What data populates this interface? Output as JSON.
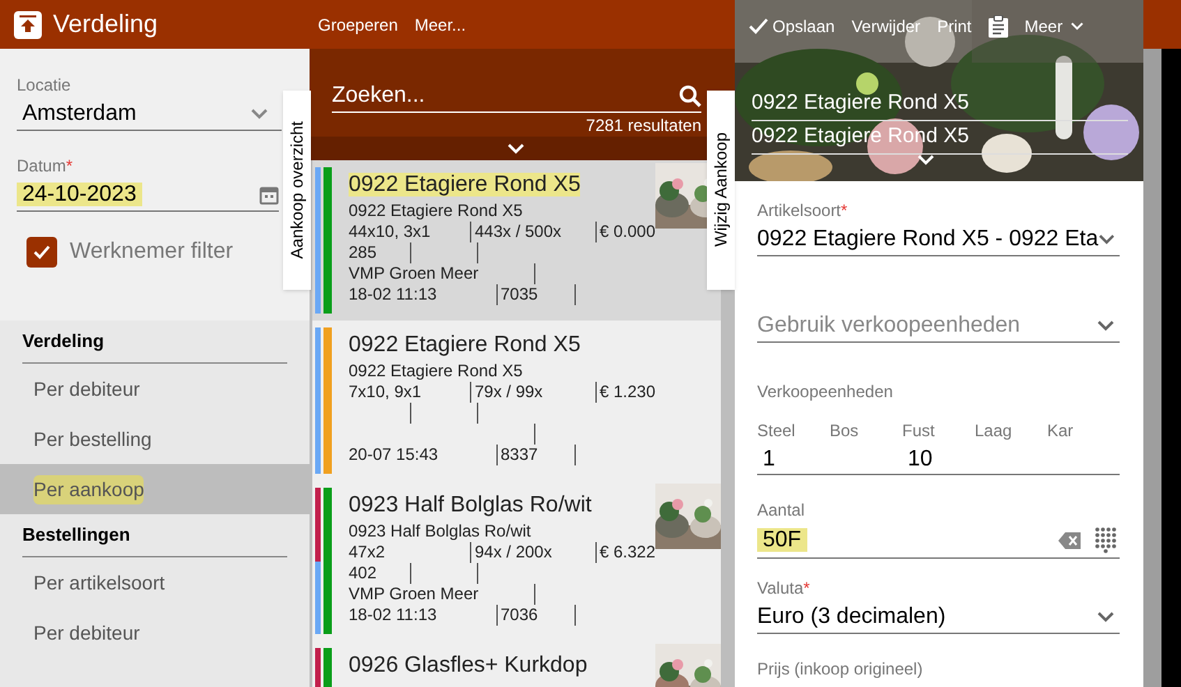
{
  "app_bar": {
    "title": "Verdeling",
    "actions": [
      "Groeperen",
      "Meer..."
    ]
  },
  "filters": {
    "location": {
      "label": "Locatie",
      "value": "Amsterdam"
    },
    "date": {
      "label": "Datum",
      "required_mark": "*",
      "value": "24-10-2023",
      "highlighted": true
    },
    "employee_filter": {
      "label": "Werknemer filter",
      "checked": true
    }
  },
  "menu": [
    {
      "heading": "Verdeling",
      "items": [
        {
          "label": "Per debiteur",
          "selected": false,
          "highlighted": false
        },
        {
          "label": "Per bestelling",
          "selected": false,
          "highlighted": false
        },
        {
          "label": "Per aankoop",
          "selected": true,
          "highlighted": true
        }
      ]
    },
    {
      "heading": "Bestellingen",
      "items": [
        {
          "label": "Per artikelsoort",
          "selected": false,
          "highlighted": false
        },
        {
          "label": "Per debiteur",
          "selected": false,
          "highlighted": false
        }
      ]
    }
  ],
  "overview_tab": "Aankoop overzicht",
  "edit_tab": "Wijzig Aankoop",
  "search": {
    "placeholder": "Zoeken...",
    "result_count": "7281 resultaten"
  },
  "purchases": [
    {
      "title": "0922 Etagiere Rond X5",
      "highlighted": true,
      "selected": true,
      "stripes": [
        {
          "color": "#6aa8f5"
        }
      ],
      "color": "#0a9e1a",
      "subtitle": "0922 Etagiere Rond X5",
      "size": "44x10, 3x1",
      "quantity": "443x / 500x",
      "price": "€ 0.000",
      "count": "285",
      "supplier": "VMP Groen Meer",
      "time": "18-02 11:13",
      "number": "7035",
      "thumbnail": {
        "kind": "picture"
      }
    },
    {
      "title": "0922 Etagiere Rond X5",
      "highlighted": false,
      "selected": false,
      "stripes": [
        {
          "color": "#6aa8f5"
        }
      ],
      "color": "#f0a020",
      "subtitle": "0922 Etagiere Rond X5",
      "size": "7x10, 9x1",
      "quantity": "79x / 99x",
      "price": "€ 1.230",
      "time": "20-07 15:43",
      "number": "8337"
    },
    {
      "title": "0923 Half Bolglas Ro/wit",
      "highlighted": false,
      "selected": false,
      "stripes": [
        {
          "color": "#c2204c"
        },
        {
          "color": "#6aa8f5"
        }
      ],
      "color": "#0a9e1a",
      "subtitle": "0923 Half Bolglas Ro/wit",
      "size": "47x2",
      "quantity": "94x / 200x",
      "price": "€ 6.322",
      "count": "402",
      "supplier": "VMP Groen Meer",
      "time": "18-02 11:13",
      "number": "7036",
      "thumbnail": {
        "kind": "picture"
      }
    },
    {
      "title": "0926 Glasfles+ Kurkdop",
      "highlighted": false,
      "selected": false,
      "stripes": [
        {
          "color": "#c2204c"
        }
      ],
      "color": "#0a9e1a",
      "thumbnail": {
        "kind": "picture"
      }
    }
  ],
  "detail": {
    "toolbar": [
      {
        "kind": "save",
        "label": "Opslaan"
      },
      {
        "kind": "text",
        "label": "Verwijder"
      },
      {
        "kind": "text",
        "label": "Print"
      },
      {
        "kind": "clipboard"
      },
      {
        "kind": "menu",
        "label": "Meer"
      }
    ],
    "titles": [
      "0922 Etagiere Rond X5",
      "0922 Etagiere Rond X5"
    ],
    "fields": [
      {
        "kind": "select",
        "label": "Artikelsoort",
        "required_mark": "*",
        "value": "0922 Etagiere Rond X5 - 0922 Eta"
      },
      {
        "kind": "select",
        "placeholder": "Gebruik verkoopeenheden"
      },
      {
        "kind": "units",
        "label": "Verkoopeenheden",
        "units": [
          {
            "label": "Steel",
            "value": "1"
          },
          {
            "label": "Bos"
          },
          {
            "label": "Fust",
            "value": "10"
          },
          {
            "label": "Laag"
          },
          {
            "label": "Kar"
          }
        ]
      },
      {
        "kind": "number",
        "label": "Aantal",
        "value": "50F",
        "highlighted": true
      },
      {
        "kind": "select",
        "label": "Valuta",
        "required_mark": "*",
        "value": "Euro (3 decimalen)"
      },
      {
        "kind": "label",
        "label": "Prijs (inkoop origineel)"
      }
    ]
  }
}
